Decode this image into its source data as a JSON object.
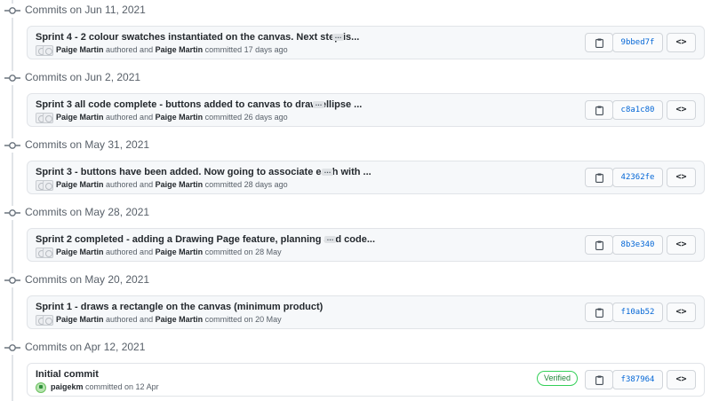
{
  "groups": [
    {
      "date_label": "Commits on Jun 11, 2021",
      "title": "Sprint 4 - 2 colour swatches instantiated on the canvas. Next step is...",
      "author": "Paige Martin",
      "authored_text": "authored and",
      "committer": "Paige Martin",
      "committed_text": "committed 17 days ago",
      "sha": "9bbed7f"
    },
    {
      "date_label": "Commits on Jun 2, 2021",
      "title": "Sprint 3 all code complete - buttons added to canvas to draw ellipse ...",
      "author": "Paige Martin",
      "authored_text": "authored and",
      "committer": "Paige Martin",
      "committed_text": "committed 26 days ago",
      "sha": "c8a1c80"
    },
    {
      "date_label": "Commits on May 31, 2021",
      "title": "Sprint 3 - buttons have been added. Now going to associate each with ...",
      "author": "Paige Martin",
      "authored_text": "authored and",
      "committer": "Paige Martin",
      "committed_text": "committed 28 days ago",
      "sha": "42362fe"
    },
    {
      "date_label": "Commits on May 28, 2021",
      "title": "Sprint 2 completed - adding a Drawing Page feature, planning and code...",
      "author": "Paige Martin",
      "authored_text": "authored and",
      "committer": "Paige Martin",
      "committed_text": "committed on 28 May",
      "sha": "8b3e340"
    },
    {
      "date_label": "Commits on May 20, 2021",
      "title": "Sprint 1 - draws a rectangle on the canvas (minimum product)",
      "author": "Paige Martin",
      "authored_text": "authored and",
      "committer": "Paige Martin",
      "committed_text": "committed on 20 May",
      "sha": "f10ab52"
    },
    {
      "date_label": "Commits on Apr 12, 2021",
      "title": "Initial commit",
      "committer": "paigekm",
      "committed_text": "committed on 12 Apr",
      "verified_label": "Verified",
      "sha": "f387964"
    }
  ],
  "ellipsis_label": "…",
  "browse_label": "<>",
  "icons": {
    "commit": "git-commit-icon",
    "copy": "clipboard-icon",
    "avatar": "identicon-avatar"
  },
  "colors": {
    "link": "#0366d6",
    "verified": "#22863a",
    "muted": "#586069"
  }
}
